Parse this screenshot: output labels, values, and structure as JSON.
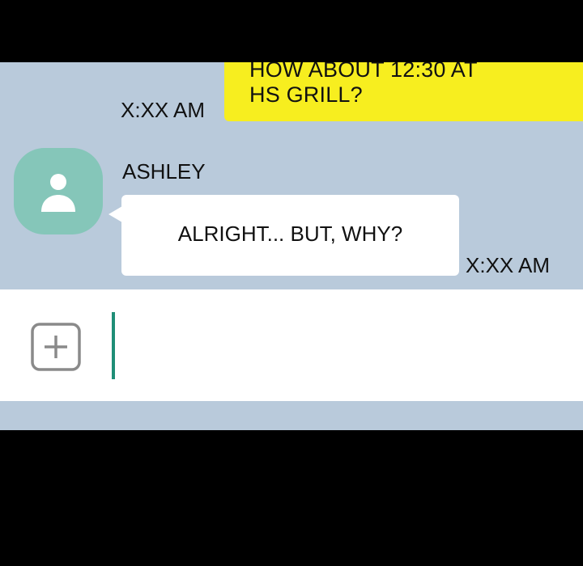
{
  "conversation": {
    "outgoing": {
      "lines": [
        "HOW ABOUT 12:30 AT",
        "HS GRILL?"
      ],
      "time": "X:XX AM"
    },
    "incoming": {
      "sender": "ASHLEY",
      "text": "ALRIGHT... BUT, WHY?",
      "time": "X:XX AM",
      "avatar_icon": "person-silhouette-icon"
    }
  },
  "composer": {
    "add_icon": "plus-square-icon",
    "value": ""
  },
  "colors": {
    "chat_background": "#b9cadb",
    "outgoing_bubble": "#f7ee1f",
    "incoming_bubble": "#ffffff",
    "avatar": "#85c6b9",
    "cursor": "#1f8e77",
    "letterbox": "#000000"
  }
}
